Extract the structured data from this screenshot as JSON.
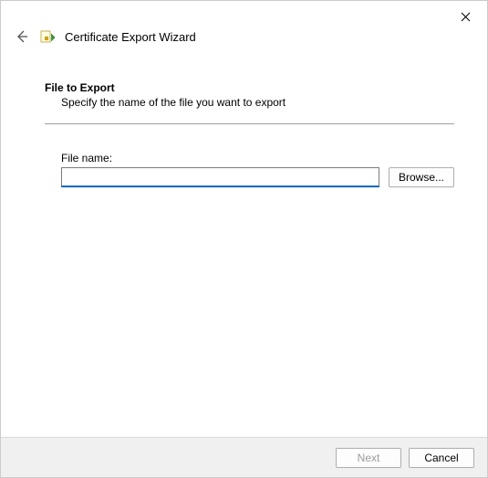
{
  "header": {
    "title": "Certificate Export Wizard"
  },
  "section": {
    "heading": "File to Export",
    "subtitle": "Specify the name of the file you want to export"
  },
  "form": {
    "file_label": "File name:",
    "file_value": "",
    "browse_label": "Browse..."
  },
  "footer": {
    "next_label": "Next",
    "cancel_label": "Cancel"
  }
}
